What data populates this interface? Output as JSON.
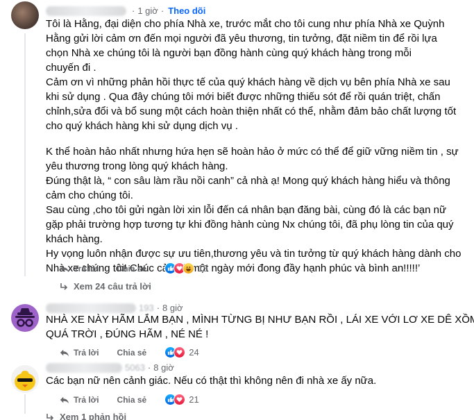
{
  "comments": [
    {
      "time": "1 giờ",
      "follow_label": "Theo dõi",
      "lines": [
        "Tôi là Hằng, đại diện cho phía Nhà xe, trước mắt cho tôi cung như phía Nhà xe Quỳnh",
        "Hằng gửi lời cảm ơn đến mọi người đã yêu thương, tin tưởng, đặt niềm tin để rồi lựa",
        "chọn Nhà xe chúng tôi là người bạn đồng hành cùng quý khách hàng trong mỗi",
        "chuyến đi .",
        "Cảm ơn vì những phản hồi thực tế của quý khách hàng về dịch vụ bên phía Nhà xe sau",
        "khi sử dụng . Qua đây chúng tôi mới biết được những thiếu sót để rồi quán triệt, chấn",
        "chỉnh,sửa đổi và bổ sung một cách hoàn thiện nhất có thể, nhằm đảm bảo chất lượng tốt",
        "cho quý khách hàng khi sử dụng dịch vụ .",
        "",
        "K thể hoàn hảo nhất nhưng hứa hẹn sẽ hoàn hảo ở mức có thể để giữ vững niềm tin , sự",
        "yêu thương trong lòng quý khách hàng.",
        "Đúng thật là, “ con sâu làm rầu nồi canh” cả nhà ạ! Mong quý khách hàng hiểu và thông",
        "cảm cho chúng tôi.",
        "Sau cùng ,cho tôi gửi ngàn lời xin lỗi đến cá nhân bạn đăng bài, cùng đó là các bạn nữ",
        "gặp phải trường hợp tương tự khi đồng hành cùng Nx chúng tôi, đã phụ lòng tin của quý",
        "khách hàng.",
        "Hy vọng luôn nhận được sự ưu tiên,thương yêu và tin tưởng từ quý khách hàng dành cho",
        "Nhà xe chúng tôi! Chúc cả nhà một ngày mới đong đầy hạnh phúc và bình an!!!!!’"
      ],
      "reply_label": "Trả lời",
      "share_label": "Chia sẻ",
      "reaction_count": "18",
      "view_replies_label": "Xem 24 câu trả lời"
    },
    {
      "time": "8 giờ",
      "name_suffix": "193",
      "lines": [
        "NHÀ XE NÀY HÃM LẮM BẠN , MÌNH TỪNG BỊ NHƯ BẠN RỒI , LÁI XE VỚI LƠ XE DÊ XỒM",
        "QUÁ TRỜI , ĐÚNG HÃM , NÉ NÉ !"
      ],
      "reply_label": "Trả lời",
      "share_label": "Chia sẻ",
      "reaction_count": "24"
    },
    {
      "time": "8 giờ",
      "name_suffix": "5063",
      "lines": [
        "Các bạn nữ nên cảnh giác. Nếu có thật thì không nên đi nhà xe ấy nữa."
      ],
      "reply_label": "Trả lời",
      "share_label": "Chia sẻ",
      "reaction_count": "21",
      "view_replies_label": "Xem 1 phản hồi"
    }
  ],
  "colors": {
    "text": "#050505",
    "secondary": "#65676b",
    "accent": "#0866ff",
    "like": "#0866ff",
    "love": "#f02849",
    "haha": "#f7b125"
  },
  "icons": {
    "reply": "reply-icon",
    "share": "share-icon",
    "like": "like-reaction-icon",
    "love": "love-reaction-icon",
    "haha": "haha-reaction-icon",
    "replies_arrow": "reply-arrow-icon"
  }
}
